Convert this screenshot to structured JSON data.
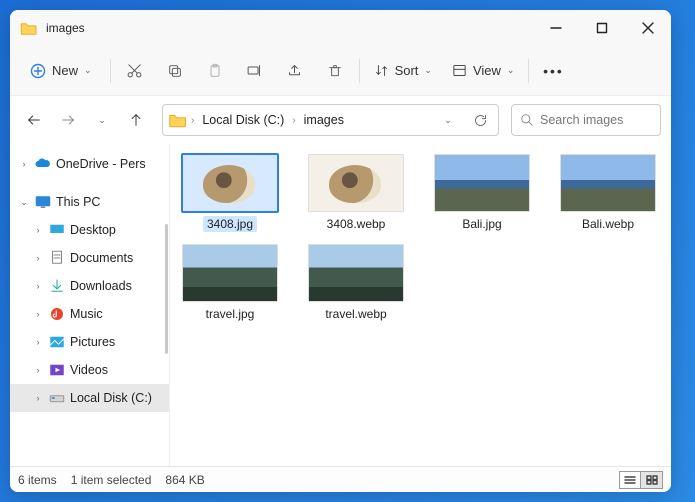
{
  "window": {
    "title": "images"
  },
  "toolbar": {
    "new_label": "New",
    "sort_label": "Sort",
    "view_label": "View"
  },
  "breadcrumb": {
    "crumb1": "Local Disk (C:)",
    "crumb2": "images"
  },
  "search": {
    "placeholder": "Search images"
  },
  "sidebar": {
    "items": [
      {
        "label": "OneDrive - Pers"
      },
      {
        "label": "This PC"
      },
      {
        "label": "Desktop"
      },
      {
        "label": "Documents"
      },
      {
        "label": "Downloads"
      },
      {
        "label": "Music"
      },
      {
        "label": "Pictures"
      },
      {
        "label": "Videos"
      },
      {
        "label": "Local Disk (C:)"
      }
    ]
  },
  "files": [
    {
      "name": "3408.jpg",
      "art": "dog",
      "selected": true
    },
    {
      "name": "3408.webp",
      "art": "dog",
      "selected": false
    },
    {
      "name": "Bali.jpg",
      "art": "sea",
      "selected": false
    },
    {
      "name": "Bali.webp",
      "art": "sea",
      "selected": false
    },
    {
      "name": "travel.jpg",
      "art": "cliff",
      "selected": false
    },
    {
      "name": "travel.webp",
      "art": "cliff",
      "selected": false
    }
  ],
  "status": {
    "count": "6 items",
    "selection": "1 item selected",
    "size": "864 KB"
  }
}
